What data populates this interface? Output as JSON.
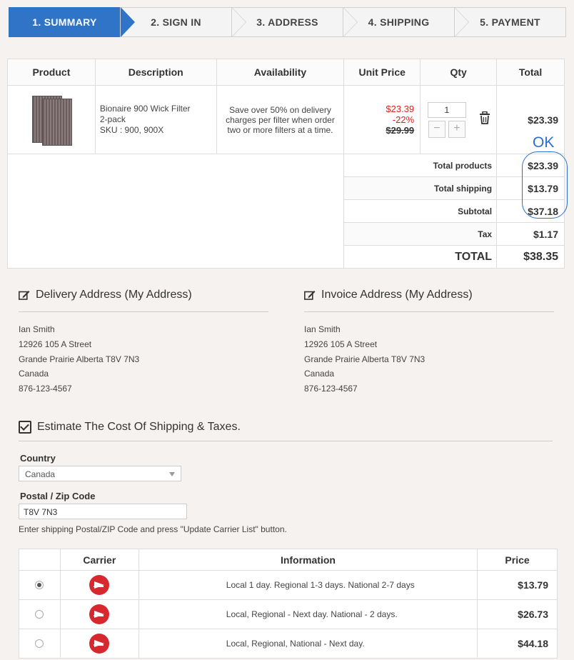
{
  "steps": [
    "1. SUMMARY",
    "2. SIGN IN",
    "3. ADDRESS",
    "4. SHIPPING",
    "5. PAYMENT"
  ],
  "cart": {
    "headers": {
      "product": "Product",
      "description": "Description",
      "availability": "Availability",
      "unit_price": "Unit Price",
      "qty": "Qty",
      "total": "Total"
    },
    "item": {
      "name_line1": "Bionaire 900 Wick Filter",
      "name_line2": "2-pack",
      "sku": "SKU : 900, 900X",
      "availability": "Save over 50% on delivery charges per filter when order two or more filters at a time.",
      "price": "$23.39",
      "discount": "-22%",
      "old_price": "$29.99",
      "qty": "1",
      "total": "$23.39"
    },
    "summary": [
      {
        "label": "Total products",
        "value": "$23.39"
      },
      {
        "label": "Total shipping",
        "value": "$13.79"
      },
      {
        "label": "Subtotal",
        "value": "$37.18"
      },
      {
        "label": "Tax",
        "value": "$1.17"
      },
      {
        "label": "TOTAL",
        "value": "$38.35"
      }
    ]
  },
  "annotation": "OK",
  "delivery": {
    "title": "Delivery Address (My Address)",
    "lines": [
      "Ian Smith",
      "12926 105 A Street",
      "Grande Prairie Alberta T8V 7N3",
      "Canada",
      "876-123-4567"
    ]
  },
  "invoice": {
    "title": "Invoice Address (My Address)",
    "lines": [
      "Ian Smith",
      "12926 105 A Street",
      "Grande Prairie Alberta T8V 7N3",
      "Canada",
      "876-123-4567"
    ]
  },
  "estimate": {
    "title": "Estimate The Cost Of Shipping & Taxes.",
    "country_label": "Country",
    "country_value": "Canada",
    "zip_label": "Postal / Zip Code",
    "zip_value": "T8V 7N3",
    "hint": "Enter shipping Postal/ZIP Code and press \"Update Carrier List\" button.",
    "headers": {
      "carrier": "Carrier",
      "information": "Information",
      "price": "Price"
    },
    "rows": [
      {
        "info": "Local 1 day. Regional 1-3 days. National 2-7 days",
        "price": "$13.79",
        "selected": true
      },
      {
        "info": "Local, Regional - Next day. National - 2 days.",
        "price": "$26.73",
        "selected": false
      },
      {
        "info": "Local, Regional, National - Next day.",
        "price": "$44.18",
        "selected": false
      }
    ]
  },
  "colors": {
    "accent": "#2f74c6",
    "sale": "#dd2222",
    "annotation": "#2a6ed1"
  }
}
